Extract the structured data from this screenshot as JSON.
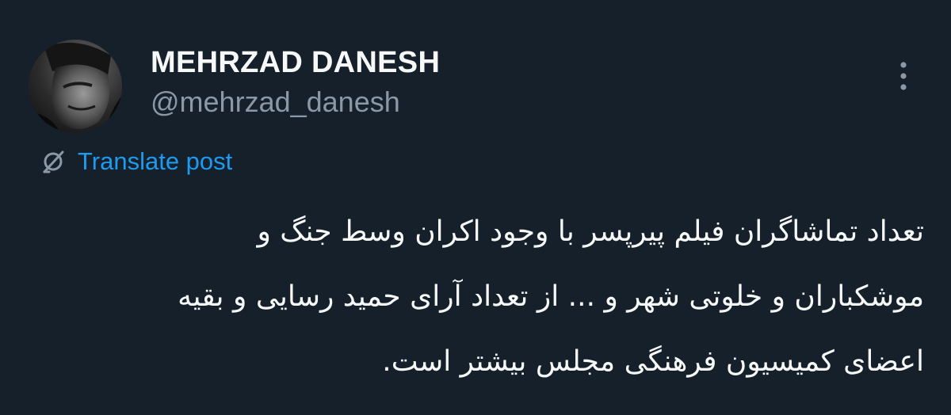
{
  "author": {
    "display_name": "MEHRZAD DANESH",
    "handle": "@mehrzad_danesh",
    "avatar_icon": "user-avatar-photo"
  },
  "actions": {
    "more_icon": "more-vertical-icon",
    "translate_icon": "translate-globe-icon",
    "translate_label": "Translate post"
  },
  "post": {
    "lines": [
      "تعداد تماشاگران فیلم پیرپسر با وجود اکران وسط جنگ و",
      "موشکباران و خلوتی شهر و ... از تعداد آرای حمید رسایی و بقیه",
      "اعضای کمیسیون فرهنگی مجلس بیشتر است."
    ]
  },
  "colors": {
    "background": "#15202b",
    "primary_text": "#f7f9f9",
    "secondary_text": "#8b98a5",
    "accent": "#1d9bf0"
  }
}
